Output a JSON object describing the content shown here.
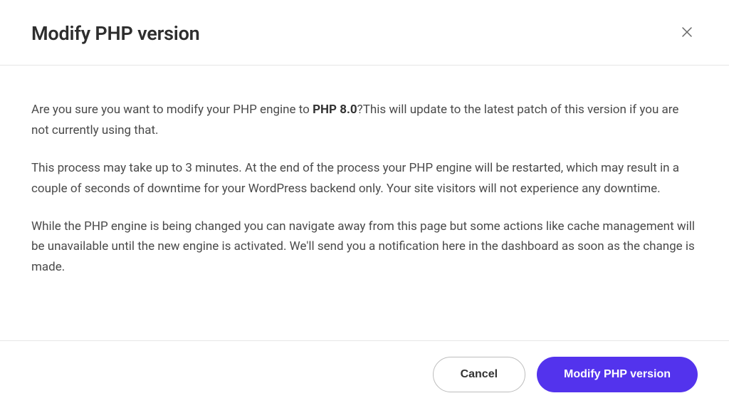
{
  "header": {
    "title": "Modify PHP version"
  },
  "body": {
    "p1_prefix": "Are you sure you want to modify your PHP engine to ",
    "p1_version": "PHP 8.0",
    "p1_suffix": "?This will update to the latest patch of this version if you are not currently using that.",
    "p2": "This process may take up to 3 minutes. At the end of the process your PHP engine will be restarted, which may result in a couple of seconds of downtime for your WordPress backend only. Your site visitors will not experience any downtime.",
    "p3": "While the PHP engine is being changed you can navigate away from this page but some actions like cache management will be unavailable until the new engine is activated. We'll send you a notification here in the dashboard as soon as the change is made."
  },
  "footer": {
    "cancel_label": "Cancel",
    "confirm_label": "Modify PHP version"
  }
}
